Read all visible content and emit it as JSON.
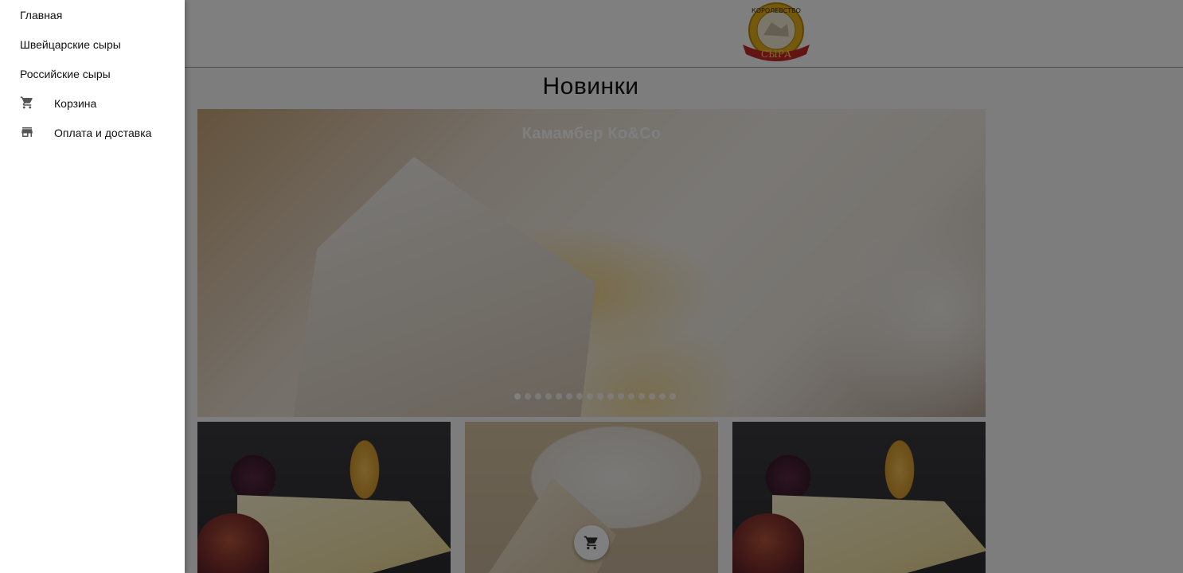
{
  "header": {
    "logo_text_top": "КОРОЛЕВСТВО",
    "logo_text_bottom": "СЫРА"
  },
  "main": {
    "title": "Новинки",
    "hero": {
      "caption": "Камамбер Ко&Co",
      "dots_count": 16,
      "active_dot": 0
    },
    "cards": [
      {
        "image": "hard-cheese-with-figs-and-honey"
      },
      {
        "image": "camembert-wheel"
      },
      {
        "image": "hard-cheese-with-figs-and-honey"
      }
    ],
    "cart_fab_icon": "shopping-cart-icon"
  },
  "drawer": {
    "items": [
      {
        "label": "Главная",
        "icon": null
      },
      {
        "label": "Швейцарские сыры",
        "icon": null
      },
      {
        "label": "Российские сыры",
        "icon": null
      },
      {
        "label": "Корзина",
        "icon": "shopping-cart-icon"
      },
      {
        "label": "Оплата и доставка",
        "icon": "store-icon"
      }
    ]
  },
  "colors": {
    "scrim": "#000000",
    "logo_gold": "#e9b21b",
    "logo_ribbon": "#c62828"
  }
}
